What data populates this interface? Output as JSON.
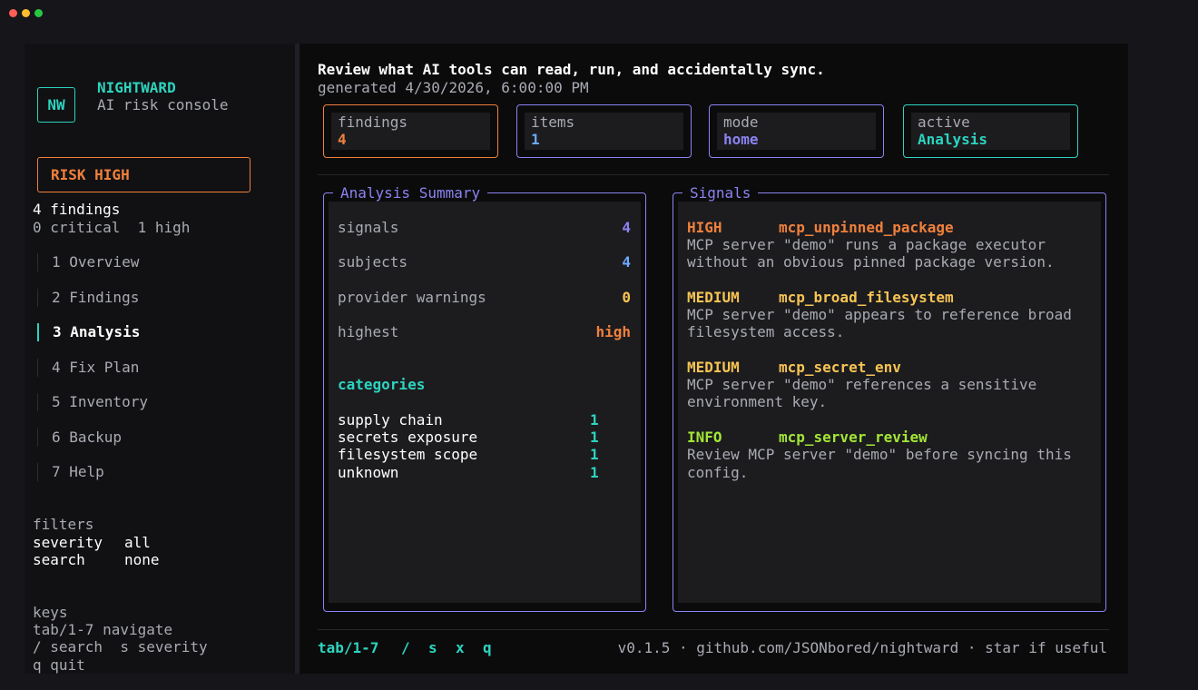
{
  "colors": {
    "teal": "#2dd4bf",
    "orange": "#f0803c",
    "purple": "#8b83f0",
    "blue": "#6ea8ff",
    "yellow": "#f7c453",
    "green": "#a3e635",
    "muted": "#a9abb3"
  },
  "window_controls": [
    "close-dot",
    "minimize-dot",
    "zoom-dot"
  ],
  "sidebar": {
    "logo": "NW",
    "brand": "NIGHTWARD",
    "subtitle": "AI risk console",
    "risk": "RISK HIGH",
    "findings_count": "4 findings",
    "severity_counts": "0 critical  1 high",
    "nav": [
      {
        "label": "1 Overview",
        "active": false
      },
      {
        "label": "2 Findings",
        "active": false
      },
      {
        "label": "3 Analysis",
        "active": true
      },
      {
        "label": "4 Fix Plan",
        "active": false
      },
      {
        "label": "5 Inventory",
        "active": false
      },
      {
        "label": "6 Backup",
        "active": false
      },
      {
        "label": "7 Help",
        "active": false
      }
    ],
    "filters": {
      "heading": "filters",
      "severity_label": "severity",
      "severity_value": "all",
      "search_label": "search",
      "search_value": "none"
    },
    "keys": {
      "heading": "keys",
      "line1": "tab/1-7 navigate",
      "line2": "/ search  s severity",
      "line3": "q quit"
    }
  },
  "header": {
    "title": "Review what AI tools can read, run, and accidentally sync.",
    "generated": "generated 4/30/2026, 6:00:00 PM"
  },
  "stats": [
    {
      "label": "findings",
      "value": "4"
    },
    {
      "label": "items",
      "value": "1"
    },
    {
      "label": "mode",
      "value": "home"
    },
    {
      "label": "active",
      "value": "Analysis"
    }
  ],
  "summary": {
    "title": "Analysis Summary",
    "rows": [
      {
        "label": "signals",
        "value": "4"
      },
      {
        "label": "subjects",
        "value": "4"
      },
      {
        "label": "provider warnings",
        "value": "0"
      },
      {
        "label": "highest",
        "value": "high"
      }
    ],
    "categories_heading": "categories",
    "categories": [
      {
        "label": "supply chain",
        "value": "1"
      },
      {
        "label": "secrets exposure",
        "value": "1"
      },
      {
        "label": "filesystem scope",
        "value": "1"
      },
      {
        "label": "unknown",
        "value": "1"
      }
    ]
  },
  "signals": {
    "title": "Signals",
    "items": [
      {
        "severity": "HIGH",
        "id": "mcp_unpinned_package",
        "line1": "MCP server \"demo\" runs a package executor",
        "line2": "without an obvious pinned package version."
      },
      {
        "severity": "MEDIUM",
        "id": "mcp_broad_filesystem",
        "line1": "MCP server \"demo\" appears to reference broad",
        "line2": "filesystem access."
      },
      {
        "severity": "MEDIUM",
        "id": "mcp_secret_env",
        "line1": "MCP server \"demo\" references a sensitive",
        "line2": "environment key."
      },
      {
        "severity": "INFO",
        "id": "mcp_server_review",
        "line1": "Review MCP server \"demo\" before syncing this",
        "line2": "config."
      }
    ]
  },
  "footer": {
    "keys": [
      {
        "label": "tab/1-7"
      },
      {
        "label": "/"
      },
      {
        "label": "s"
      },
      {
        "label": "x"
      },
      {
        "label": "q"
      }
    ],
    "version": "v0.1.5 · github.com/JSONbored/nightward · star if useful"
  }
}
